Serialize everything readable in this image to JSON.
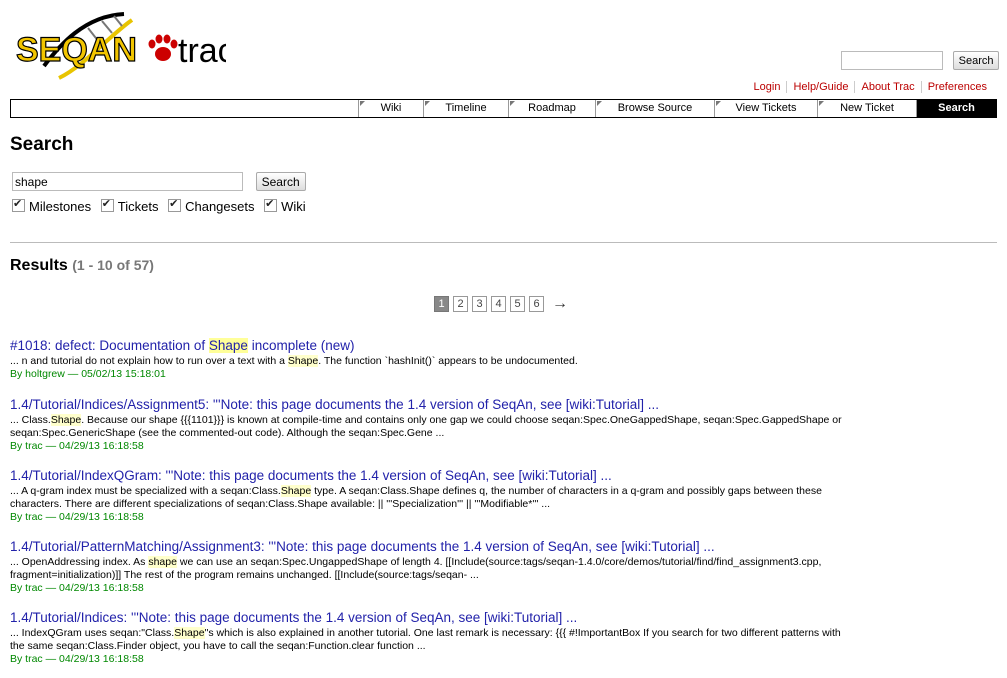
{
  "logo": {
    "text_left": "SEQAN",
    "text_right": "trac"
  },
  "top_search": {
    "placeholder": "",
    "button": "Search"
  },
  "metanav": [
    "Login",
    "Help/Guide",
    "About Trac",
    "Preferences"
  ],
  "mainnav": [
    {
      "label": "Wiki",
      "active": false
    },
    {
      "label": "Timeline",
      "active": false
    },
    {
      "label": "Roadmap",
      "active": false
    },
    {
      "label": "Browse Source",
      "active": false
    },
    {
      "label": "View Tickets",
      "active": false
    },
    {
      "label": "New Ticket",
      "active": false
    },
    {
      "label": "Search",
      "active": true
    }
  ],
  "page_title": "Search",
  "search": {
    "query": "shape",
    "button": "Search",
    "filters": [
      {
        "label": "Milestones",
        "checked": true
      },
      {
        "label": "Tickets",
        "checked": true
      },
      {
        "label": "Changesets",
        "checked": true
      },
      {
        "label": "Wiki",
        "checked": true
      }
    ]
  },
  "results_header": {
    "label": "Results",
    "count": "(1 - 10 of 57)"
  },
  "pager": {
    "pages": [
      "1",
      "2",
      "3",
      "4",
      "5",
      "6"
    ],
    "current": "1",
    "next": "→"
  },
  "results": [
    {
      "title_parts": [
        "#1018: defect: Documentation of ",
        "Shape",
        " incomplete (new)"
      ],
      "excerpt_lines": [
        [
          "... n and tutorial do not explain how to run over a text with a ",
          "Shape",
          ". The function `hashInit()` appears to be undocumented."
        ]
      ],
      "meta": "By holtgrew — 05/02/13 15:18:01"
    },
    {
      "title_parts": [
        "1.4/Tutorial/Indices/Assignment5: '''Note: this page documents the 1.4 version of SeqAn, see [wiki:Tutorial] ..."
      ],
      "excerpt_lines": [
        [
          "... Class.",
          "Shape",
          ". Because our shape {{{1101}}} is known at compile-time and contains only one gap we could choose seqan:Spec.OneGappedShape, seqan:Spec.GappedShape or"
        ],
        [
          "seqan:Spec.GenericShape (see the commented-out code). Although the seqan:Spec.Gene ..."
        ]
      ],
      "meta": "By trac — 04/29/13 16:18:58"
    },
    {
      "title_parts": [
        "1.4/Tutorial/IndexQGram: '''Note: this page documents the 1.4 version of SeqAn, see [wiki:Tutorial] ..."
      ],
      "excerpt_lines": [
        [
          "... A q-gram index must be specialized with a seqan:Class.",
          "Shape",
          " type. A seqan:Class.Shape defines q, the number of characters in a q-gram and possibly gaps between these"
        ],
        [
          "characters. There are different specializations of seqan:Class.Shape available: || '''Specialization''' || '''Modifiable*''' ..."
        ]
      ],
      "meta": "By trac — 04/29/13 16:18:58"
    },
    {
      "title_parts": [
        "1.4/Tutorial/PatternMatching/Assignment3: '''Note: this page documents the 1.4 version of SeqAn, see [wiki:Tutorial] ..."
      ],
      "excerpt_lines": [
        [
          "... OpenAddressing index. As ",
          "shape",
          " we can use an seqan:Spec.UngappedShape of length 4. [[Include(source:tags/seqan-1.4.0/core/demos/tutorial/find/find_assignment3.cpp,"
        ],
        [
          "fragment=initialization)]] The rest of the program remains unchanged. [[Include(source:tags/seqan- ..."
        ]
      ],
      "meta": "By trac — 04/29/13 16:18:58"
    },
    {
      "title_parts": [
        "1.4/Tutorial/Indices: '''Note: this page documents the 1.4 version of SeqAn, see [wiki:Tutorial] ..."
      ],
      "excerpt_lines": [
        [
          "... IndexQGram uses seqan:\"Class.",
          "Shape",
          "\"s which is also explained in another tutorial. One last remark is necessary: {{{ #!ImportantBox If you search for two different patterns with"
        ],
        [
          "the same seqan:Class.Finder object, you have to call the seqan:Function.clear function ..."
        ]
      ],
      "meta": "By trac — 04/29/13 16:18:58"
    }
  ]
}
